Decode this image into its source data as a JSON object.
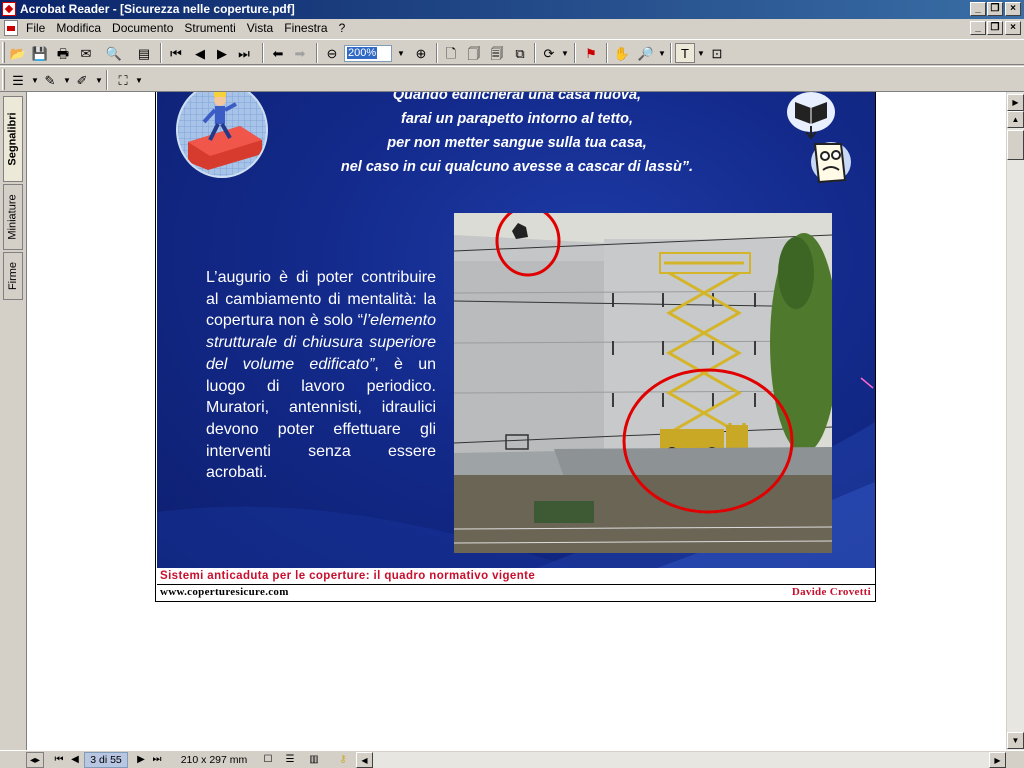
{
  "window": {
    "title": "Acrobat Reader - [Sicurezza nelle coperture.pdf]"
  },
  "menu": {
    "items": [
      "File",
      "Modifica",
      "Documento",
      "Strumenti",
      "Vista",
      "Finestra",
      "?"
    ]
  },
  "toolbar": {
    "zoom_value": "200%"
  },
  "nav_tabs": [
    "Segnalibri",
    "Miniature",
    "Firme"
  ],
  "slide": {
    "quote_lines": [
      "Quando edificherai una casa nuova,",
      "farai un parapetto intorno al tetto,",
      "per non metter sangue sulla tua casa,",
      "nel caso in cui qualcuno avesse a cascar di lassù”."
    ],
    "body_text_part1": "L’augurio è di poter contribuire al cambiamento di mentalità: la copertura non è solo “",
    "body_text_italic": "l’elemento strutturale di chiusura superiore del volume edificato”",
    "body_text_part2": ", è un luogo di lavoro periodico. Muratori, antennisti, idraulici devono poter effettuare gli interventi senza essere acrobati.",
    "footer_title": "Sistemi anticaduta per le coperture: il quadro normativo vigente",
    "footer_url": "www.coperturesicure.com",
    "footer_author": "Davide Crovetti"
  },
  "status": {
    "page": "3 di 55",
    "page_size": "210 x 297 mm"
  },
  "colors": {
    "slide_blue": "#132a8b",
    "annotation_red": "#e00000",
    "footer_red": "#c8102e",
    "titlebar": "#0a246a"
  }
}
